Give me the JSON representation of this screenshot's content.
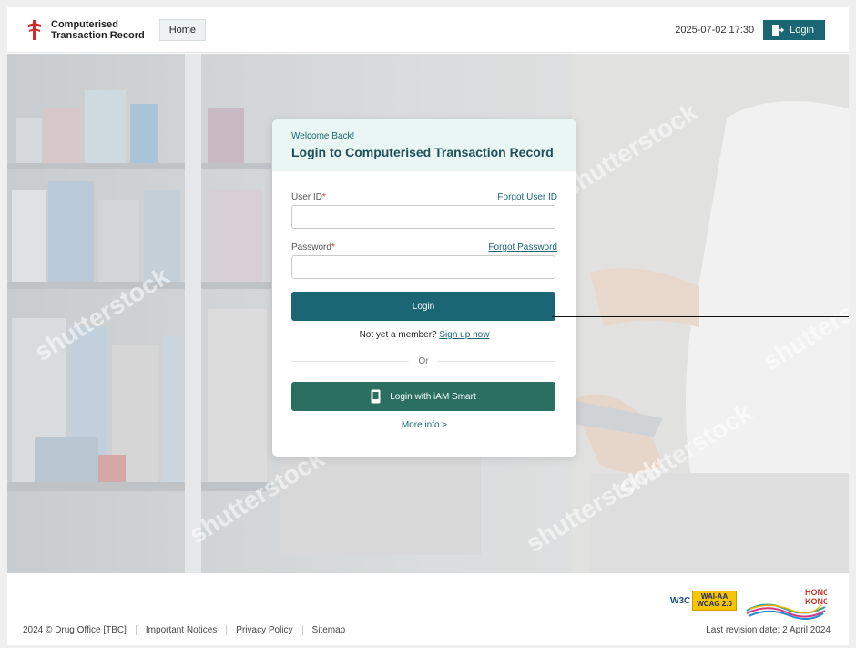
{
  "header": {
    "brand_line1": "Computerised",
    "brand_line2": "Transaction Record",
    "home_label": "Home",
    "datetime": "2025-07-02 17:30",
    "login_label": "Login"
  },
  "watermark": "shutterstock",
  "login_card": {
    "welcome": "Welcome Back!",
    "title": "Login to Computerised Transaction Record",
    "user_id_label": "User ID",
    "forgot_user_id": "Forgot User ID",
    "password_label": "Password",
    "forgot_password": "Forgot Password",
    "required_mark": "*",
    "login_button": "Login",
    "not_member": "Not yet a member?",
    "sign_up": "Sign up now",
    "or": "Or",
    "iam_smart_button": "Login with iAM Smart",
    "more_info": "More info >"
  },
  "footer": {
    "copyright": "2024 © Drug Office [TBC]",
    "important_notices": "Important Notices",
    "privacy_policy": "Privacy Policy",
    "sitemap": "Sitemap",
    "revision": "Last revision date: 2 April 2024",
    "w3c_text": "W3C",
    "wai_line1": "WAI-AA",
    "wai_line2": "WCAG 2.0",
    "hk_line1": "HONG",
    "hk_line2": "KONG"
  },
  "colors": {
    "primary": "#1a6674",
    "iam_green": "#2a6f5f",
    "card_header_bg": "#eaf6f4",
    "required": "#c0392b"
  }
}
